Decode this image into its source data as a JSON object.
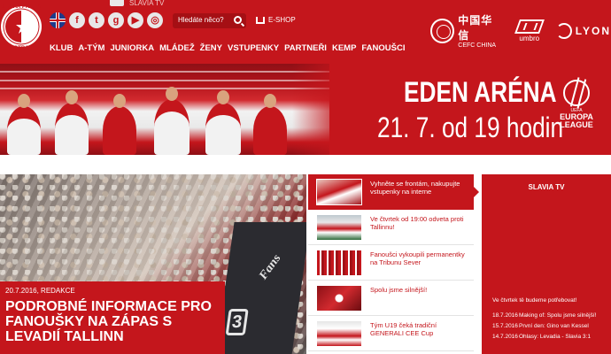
{
  "header": {
    "logo_alt": "SLAVIA PRAHA FOTBAL",
    "youtube_label": "SLAVIA TV",
    "social_icons": [
      "uk-flag-icon",
      "facebook-icon",
      "twitter-icon",
      "google-plus-icon",
      "youtube-icon",
      "instagram-icon"
    ],
    "search": {
      "placeholder": "Hledáte něco?"
    },
    "eshop_label": "E-SHOP",
    "nav": [
      "KLUB",
      "A-TÝM",
      "JUNIORKA",
      "MLÁDEŽ",
      "ŽENY",
      "VSTUPENKY",
      "PARTNEŘI",
      "KEMP",
      "FANOUŠCI"
    ],
    "partners": {
      "cefc_cn": "中国华信",
      "cefc_en": "CEFC CHINA",
      "umbro": "umbro",
      "lyon": "LYON"
    }
  },
  "banner": {
    "title": "EDEN ARÉNA",
    "date": "21. 7. od 19 hodin",
    "uel_small": "UEFA",
    "uel_line1": "EUROPA",
    "uel_line2": "LEAGUE"
  },
  "feature": {
    "flag_text": "Fans",
    "flag_number": "3",
    "meta": "20.7.2016, REDAKCE",
    "title": "PODROBNÉ INFORMACE PRO FANOUŠKY NA ZÁPAS S LEVADIÍ TALLINN"
  },
  "news": [
    {
      "text": "Vyhněte se frontám, nakupujte vstupenky na interne"
    },
    {
      "text": "Ve čtvrtek od 19:00 odveta proti Tallinnu!"
    },
    {
      "text": "Fanoušci vykoupili permanentky na Tribunu Sever"
    },
    {
      "text": "Spolu jsme silnější!"
    },
    {
      "text": "Tým U19 čeká tradiční GENERALI CEE Cup"
    }
  ],
  "tv": {
    "title": "SLAVIA TV",
    "description": "Ve čtvrtek tě budeme potřebovat!",
    "items": [
      {
        "date": "18.7.2016",
        "title": "Making of: Spolu jsme silnější!"
      },
      {
        "date": "15.7.2016",
        "title": "První den: Gino van Kessel"
      },
      {
        "date": "14.7.2016",
        "title": "Ohlasy: Levadia - Slavia 3:1"
      }
    ]
  },
  "colors": {
    "brand_red": "#c4161c",
    "white": "#ffffff"
  }
}
